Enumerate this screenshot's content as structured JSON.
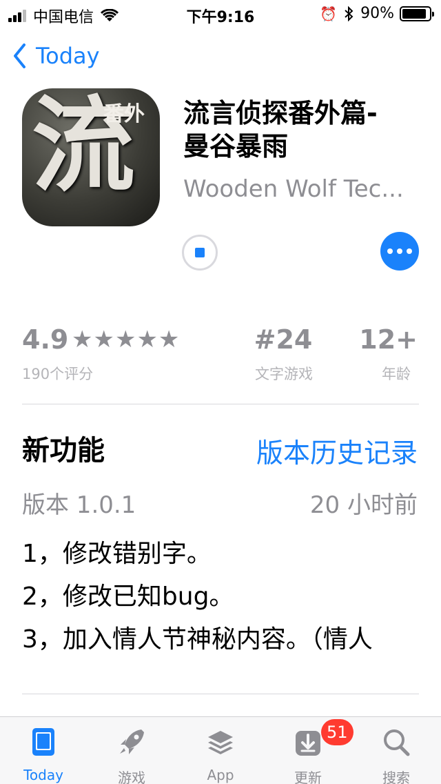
{
  "status_bar": {
    "carrier": "中国电信",
    "time": "下午9:16",
    "battery": "90%",
    "battery_level": 0.9
  },
  "nav": {
    "back_label": "Today"
  },
  "app": {
    "icon_big_char": "流",
    "icon_small_text": "番外",
    "title_line1": "流言侦探番外篇-",
    "title_line2": "曼谷暴雨",
    "developer": "Wooden Wolf Tec..."
  },
  "ratings": {
    "value": "4.9",
    "stars": "★★★★★",
    "count": "190个评分",
    "rank_value": "#24",
    "rank_label": "文字游戏",
    "age_value": "12+",
    "age_label": "年龄"
  },
  "whats_new": {
    "title": "新功能",
    "history_link": "版本历史记录",
    "version": "版本 1.0.1",
    "time_ago": "20 小时前",
    "notes": [
      "1，修改错别字。",
      "2，修改已知bug。",
      "3，加入情人节神秘内容。（情人"
    ]
  },
  "tabbar": {
    "tabs": [
      {
        "label": "Today",
        "icon": "today-icon"
      },
      {
        "label": "游戏",
        "icon": "rocket-icon"
      },
      {
        "label": "App",
        "icon": "layers-icon"
      },
      {
        "label": "更新",
        "icon": "download-icon"
      },
      {
        "label": "搜索",
        "icon": "search-icon"
      }
    ],
    "updates_badge": "51"
  },
  "colors": {
    "accent": "#1a82fb",
    "badge": "#ff3b30",
    "secondary_text": "#8e8e93"
  }
}
